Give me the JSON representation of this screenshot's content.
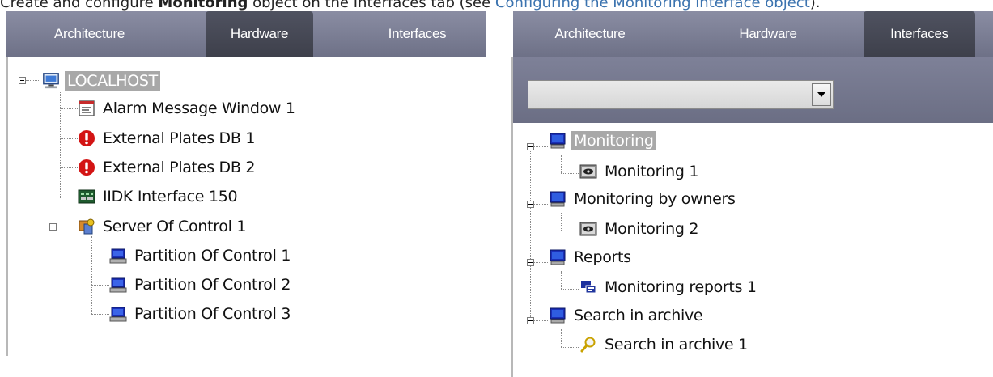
{
  "caption": {
    "prefix": "Create and configure ",
    "bold": "Monitoring",
    "middle": " object on the Interfaces tab (see ",
    "link": "Configuring the Monitoring interface object",
    "suffix": ")."
  },
  "left_panel": {
    "tabs": [
      {
        "label": "Architecture",
        "active": false
      },
      {
        "label": "Hardware",
        "active": true
      },
      {
        "label": "Interfaces",
        "active": false
      }
    ],
    "tree": [
      {
        "label": "LOCALHOST",
        "icon": "computer-icon",
        "selected": true
      },
      {
        "label": "Alarm Message Window 1",
        "icon": "message-window-icon"
      },
      {
        "label": "External Plates DB 1",
        "icon": "alert-icon"
      },
      {
        "label": "External Plates DB 2",
        "icon": "alert-icon"
      },
      {
        "label": "IIDK Interface 150",
        "icon": "interface-board-icon"
      },
      {
        "label": "Server Of Control 1",
        "icon": "server-control-icon"
      },
      {
        "label": "Partition  Of Control 1",
        "icon": "partition-icon"
      },
      {
        "label": "Partition  Of Control 2",
        "icon": "partition-icon"
      },
      {
        "label": "Partition  Of Control 3",
        "icon": "partition-icon"
      }
    ]
  },
  "right_panel": {
    "tabs": [
      {
        "label": "Architecture",
        "active": false
      },
      {
        "label": "Hardware",
        "active": false
      },
      {
        "label": "Interfaces",
        "active": true
      }
    ],
    "combo_value": "",
    "tree": [
      {
        "label": "Monitoring",
        "icon": "monitor-icon",
        "selected": true
      },
      {
        "label": "Monitoring 1",
        "icon": "monitoring-eye-icon"
      },
      {
        "label": "Monitoring by owners",
        "icon": "monitor-icon"
      },
      {
        "label": "Monitoring 2",
        "icon": "monitoring-eye-icon"
      },
      {
        "label": "Reports",
        "icon": "monitor-icon"
      },
      {
        "label": "Monitoring reports 1",
        "icon": "reports-icon"
      },
      {
        "label": "Search in archive",
        "icon": "monitor-icon"
      },
      {
        "label": "Search in archive 1",
        "icon": "magnifier-icon"
      }
    ]
  }
}
